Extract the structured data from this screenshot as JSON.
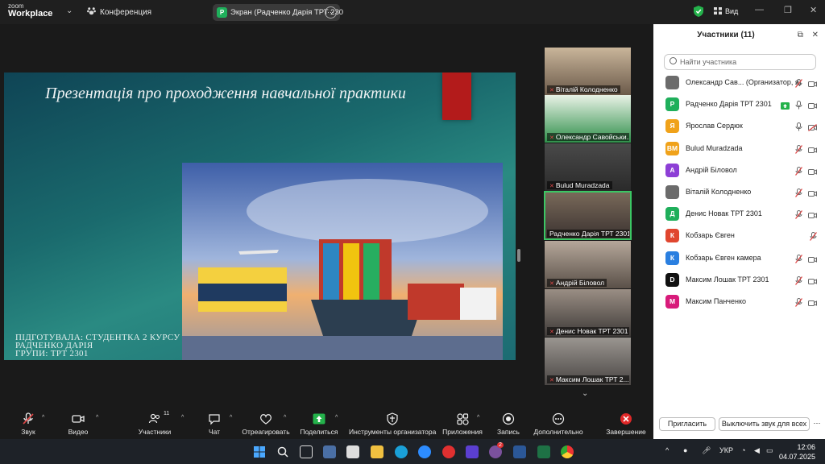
{
  "app": {
    "logo_line1": "zoom",
    "logo_line2": "Workplace",
    "meeting_label": "Конференция",
    "share_label": "Экран (Радченко Дарія ТРТ 230",
    "share_letter": "P",
    "view_label": "Вид"
  },
  "slide": {
    "title": "Презентація про проходження навчальної практики",
    "line1": "ПІДГОТУВАЛА: СТУДЕНТКА 2 КУРСУ",
    "line2": "ГРУПИ: ТРТ 2301",
    "line3": "РАДЧЕНКО ДАРІЯ"
  },
  "thumbnails": [
    {
      "name": "Віталій Колодненко"
    },
    {
      "name": "Олександр Савойськи..."
    },
    {
      "name": "Bulud Muradzada"
    },
    {
      "name": "Радченко Дарія ТРТ 2301"
    },
    {
      "name": "Андрій Біловол"
    },
    {
      "name": "Денис Новак ТРТ 2301"
    },
    {
      "name": "Максим Лошак ТРТ 2..."
    }
  ],
  "panel": {
    "title": "Участники (11)",
    "search_placeholder": "Найти участника",
    "invite": "Пригласить",
    "mute_all": "Выключить звук для всех",
    "participants": [
      {
        "avatar": "",
        "name": "Олександр Сав...  (Организатор, я)",
        "color": "#6b6b6b"
      },
      {
        "avatar": "Р",
        "name": "Радченко Дарія ТРТ 2301",
        "color": "#1faf5b"
      },
      {
        "avatar": "Я",
        "name": "Ярослав Сердюк",
        "color": "#f0a21a"
      },
      {
        "avatar": "BM",
        "name": "Bulud Muradzada",
        "color": "#f0a21a"
      },
      {
        "avatar": "А",
        "name": "Андрій Біловол",
        "color": "#8d3fd6"
      },
      {
        "avatar": "",
        "name": "Віталій Колодненко",
        "color": "#6b6b6b"
      },
      {
        "avatar": "Д",
        "name": "Денис Новак ТРТ 2301",
        "color": "#1faf5b"
      },
      {
        "avatar": "К",
        "name": "Кобзарь Євген",
        "color": "#e0462f"
      },
      {
        "avatar": "К",
        "name": "Кобзарь Євген камера",
        "color": "#2a7fe0"
      },
      {
        "avatar": "D",
        "name": "Максим Лошак ТРТ 2301",
        "color": "#111111"
      },
      {
        "avatar": "М",
        "name": "Максим Панченко",
        "color": "#d81b7a"
      }
    ]
  },
  "toolbar": {
    "audio": "Звук",
    "video": "Видео",
    "participants": "Участники",
    "participants_count": "11",
    "chat": "Чат",
    "react": "Отреагировать",
    "share": "Поделиться",
    "host_tools": "Инструменты организатора",
    "apps": "Приложения",
    "record": "Запись",
    "more": "Дополнительно",
    "end": "Завершение"
  },
  "taskbar": {
    "lang": "УКР",
    "time": "12:06",
    "date": "04.07.2025",
    "viber_badge": "2"
  },
  "colors": {
    "accent_green": "#3bc764",
    "end_red": "#e02828"
  }
}
